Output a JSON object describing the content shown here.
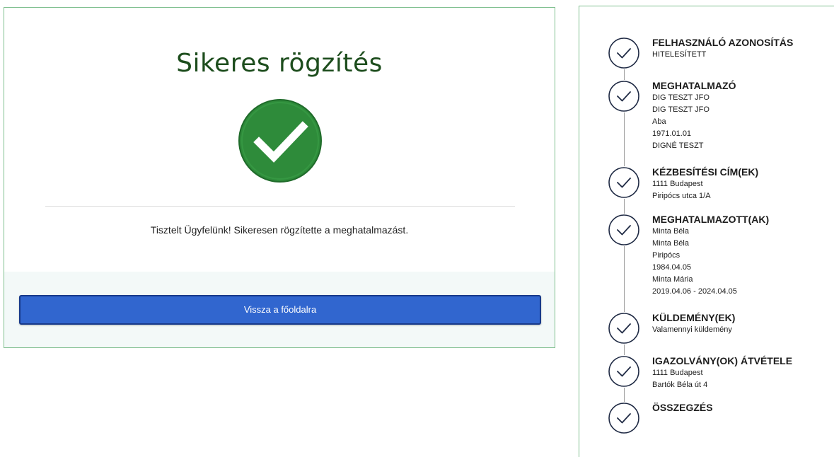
{
  "success": {
    "title": "Sikeres rögzítés",
    "message": "Tisztelt Ügyfelünk! Sikeresen rögzítette a meghatalmazást.",
    "back_button_label": "Vissza a főoldalra",
    "icon": "check-circle-icon",
    "accent_color": "#2e8b3a",
    "button_color": "#3166cf"
  },
  "steps": [
    {
      "title": "FELHASZNÁLÓ AZONOSÍTÁS",
      "lines": [
        "HITELESÍTETT"
      ],
      "icon": "check-icon"
    },
    {
      "title": "MEGHATALMAZÓ",
      "lines": [
        "DIG TESZT JFO",
        "DIG TESZT JFO",
        "Aba",
        "1971.01.01",
        "DIGNÉ TESZT"
      ],
      "icon": "check-icon"
    },
    {
      "title": "KÉZBESÍTÉSI CÍM(EK)",
      "lines": [
        "1111 Budapest",
        "Piripócs utca 1/A"
      ],
      "icon": "check-icon"
    },
    {
      "title": "MEGHATALMAZOTT(AK)",
      "lines": [
        "Minta Béla",
        "Minta Béla",
        "Piripócs",
        "1984.04.05",
        "Minta Mária",
        "2019.04.06 - 2024.04.05"
      ],
      "icon": "check-icon"
    },
    {
      "title": "KÜLDEMÉNY(EK)",
      "lines": [
        "Valamennyi küldemény"
      ],
      "icon": "check-icon"
    },
    {
      "title": "IGAZOLVÁNY(OK) ÁTVÉTELE",
      "lines": [
        "1111 Budapest",
        "Bartók Béla út 4"
      ],
      "icon": "check-icon"
    },
    {
      "title": "ÖSSZEGZÉS",
      "lines": [],
      "icon": "check-icon"
    }
  ]
}
